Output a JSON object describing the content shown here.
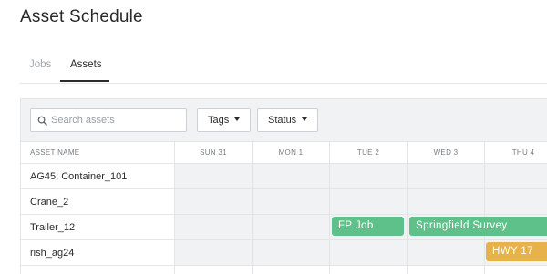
{
  "page": {
    "title": "Asset Schedule"
  },
  "tabs": [
    {
      "label": "Jobs",
      "active": false
    },
    {
      "label": "Assets",
      "active": true
    }
  ],
  "toolbar": {
    "search_placeholder": "Search assets",
    "tags_label": "Tags",
    "status_label": "Status"
  },
  "grid": {
    "name_header": "ASSET NAME",
    "days": [
      "SUN 31",
      "MON 1",
      "TUE 2",
      "WED 3",
      "THU 4"
    ],
    "assets": [
      "AG45: Container_101",
      "Crane_2",
      "Trailer_12",
      "rish_ag24"
    ]
  },
  "events": {
    "fp_job": {
      "label": "FP Job",
      "color": "#5ec18a"
    },
    "springfield": {
      "label": "Springfield Survey",
      "color": "#5ec18a"
    },
    "hwy17": {
      "label": "HWY 17",
      "color": "#e8b24a"
    }
  },
  "colors": {
    "green": "#5ec18a",
    "amber": "#e8b24a",
    "cell_bg": "#f1f2f4",
    "border": "#e3e5e8"
  }
}
